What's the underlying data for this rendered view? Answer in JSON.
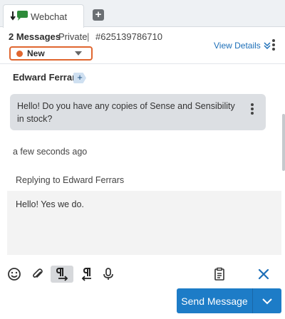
{
  "tabs": [
    {
      "label": "Webchat",
      "icon": "webchat-icon"
    }
  ],
  "add_tab_label": "+",
  "header": {
    "message_count": "2 Messages",
    "privacy": "Private",
    "separator": "|",
    "conversation_id": "#625139786710",
    "status": {
      "value": "New",
      "color": "#e0662f"
    },
    "view_details_label": "View Details"
  },
  "thread": {
    "sender_name": "Edward Ferrars",
    "sender_tag": "+",
    "message_text": "Hello! Do you have any copies of Sense and Sensibility in stock?",
    "timestamp": "a few seconds ago",
    "replying_to": "Replying to Edward Ferrars",
    "reply_text": "Hello! Yes we do."
  },
  "toolbar": {
    "icons": [
      "emoji-icon",
      "attachment-icon",
      "ltr-paragraph-icon",
      "rtl-paragraph-icon",
      "microphone-icon",
      "template-icon",
      "close-icon"
    ]
  },
  "send": {
    "label": "Send Message",
    "color": "#1d7cc7"
  },
  "colors": {
    "accent": "#1d6fb8",
    "status_orange": "#e0662f",
    "bubble_bg": "#dcdfe3"
  }
}
